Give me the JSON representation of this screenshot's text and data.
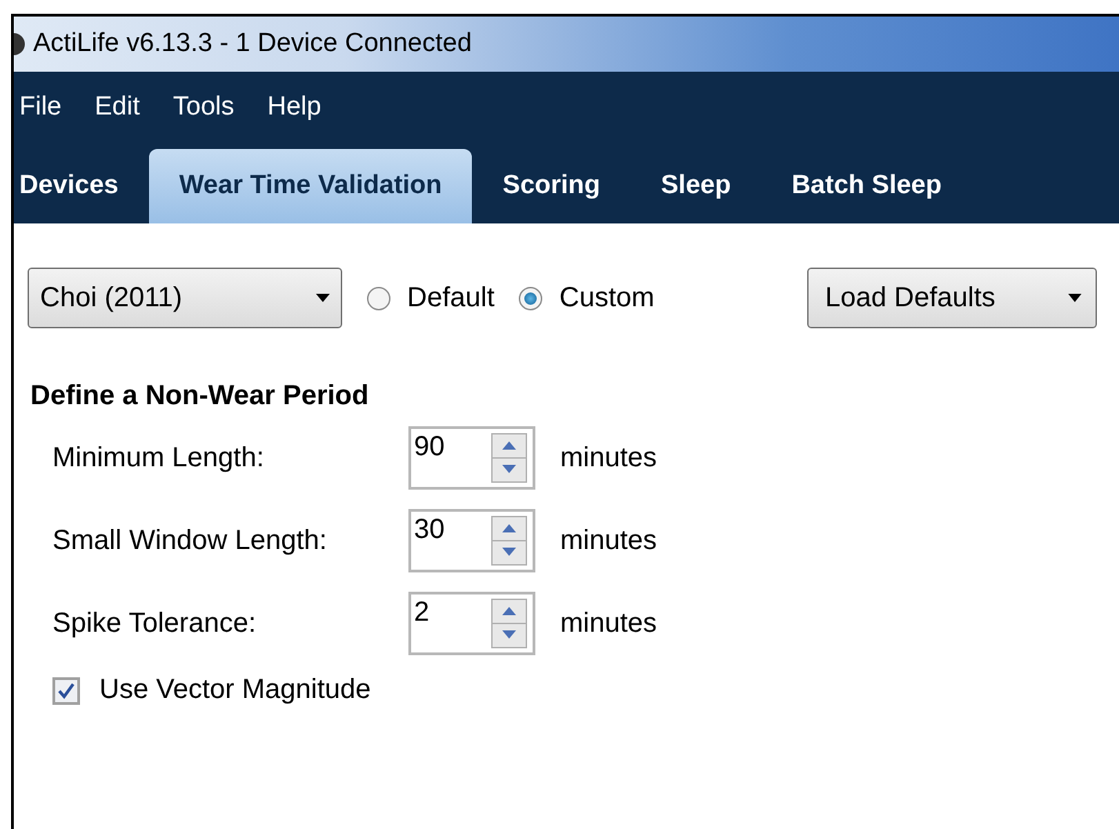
{
  "window": {
    "title": "ActiLife v6.13.3 - 1 Device Connected"
  },
  "menu": [
    "File",
    "Edit",
    "Tools",
    "Help"
  ],
  "tabs": [
    {
      "label": "Devices",
      "selected": false
    },
    {
      "label": "Wear Time Validation",
      "selected": true
    },
    {
      "label": "Scoring",
      "selected": false
    },
    {
      "label": "Sleep",
      "selected": false
    },
    {
      "label": "Batch Sleep",
      "selected": false
    }
  ],
  "algorithm": {
    "value": "Choi (2011)"
  },
  "mode": [
    {
      "label": "Default",
      "selected": false
    },
    {
      "label": "Custom",
      "selected": true
    }
  ],
  "load_defaults": {
    "label": "Load Defaults"
  },
  "section_title": "Define a Non-Wear Period",
  "settings": [
    {
      "label": "Minimum Length:",
      "value": "90",
      "unit": "minutes"
    },
    {
      "label": "Small Window Length:",
      "value": "30",
      "unit": "minutes"
    },
    {
      "label": "Spike Tolerance:",
      "value": "2",
      "unit": "minutes"
    }
  ],
  "vector_magnitude": {
    "label": "Use Vector Magnitude",
    "checked": true
  }
}
